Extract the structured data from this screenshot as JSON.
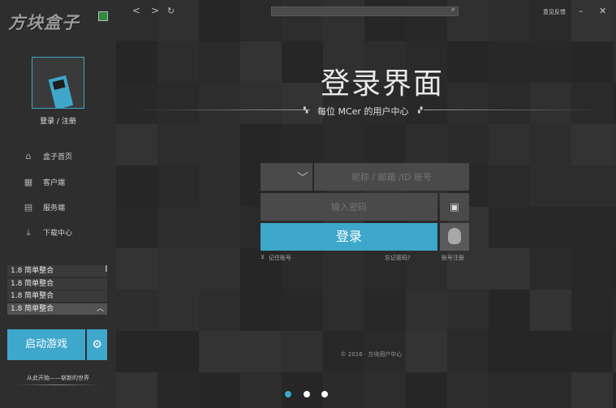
{
  "app": {
    "logo_text": "方块盒子",
    "login_register": "登录 / 注册"
  },
  "nav": [
    {
      "label": "盒子首页",
      "icon": "home-icon"
    },
    {
      "label": "客户端",
      "icon": "grid-icon"
    },
    {
      "label": "服务端",
      "icon": "server-icon"
    },
    {
      "label": "下载中心",
      "icon": "download-icon"
    }
  ],
  "versions": [
    "1.8 简单整合",
    "1.8 简单整合",
    "1.8 简单整合",
    "1.8 简单整合"
  ],
  "start_button": "启动游戏",
  "slogan": "从此开始——崭新的世界",
  "topbar": {
    "back": "<",
    "forward": ">",
    "refresh": "↻",
    "feedback": "意见反馈",
    "minimize": "–",
    "close": "✕"
  },
  "login": {
    "title": "登录界面",
    "subtitle": "每位 MCer 的用户中心",
    "account_placeholder": "昵称 / 邮箱 /ID 账号",
    "password_placeholder": "输入密码",
    "login_button": "登录",
    "remember": "记住账号",
    "forgot": "忘记密码?",
    "register": "账号注册"
  },
  "footer": {
    "copyright": "© 2016 · 方块用户中心"
  },
  "colors": {
    "accent": "#3ea7cc",
    "sidebar_bg": "#2e2e2e",
    "main_bg": "#2a2a2a"
  },
  "carousel": {
    "active_index": 0,
    "count": 3
  }
}
